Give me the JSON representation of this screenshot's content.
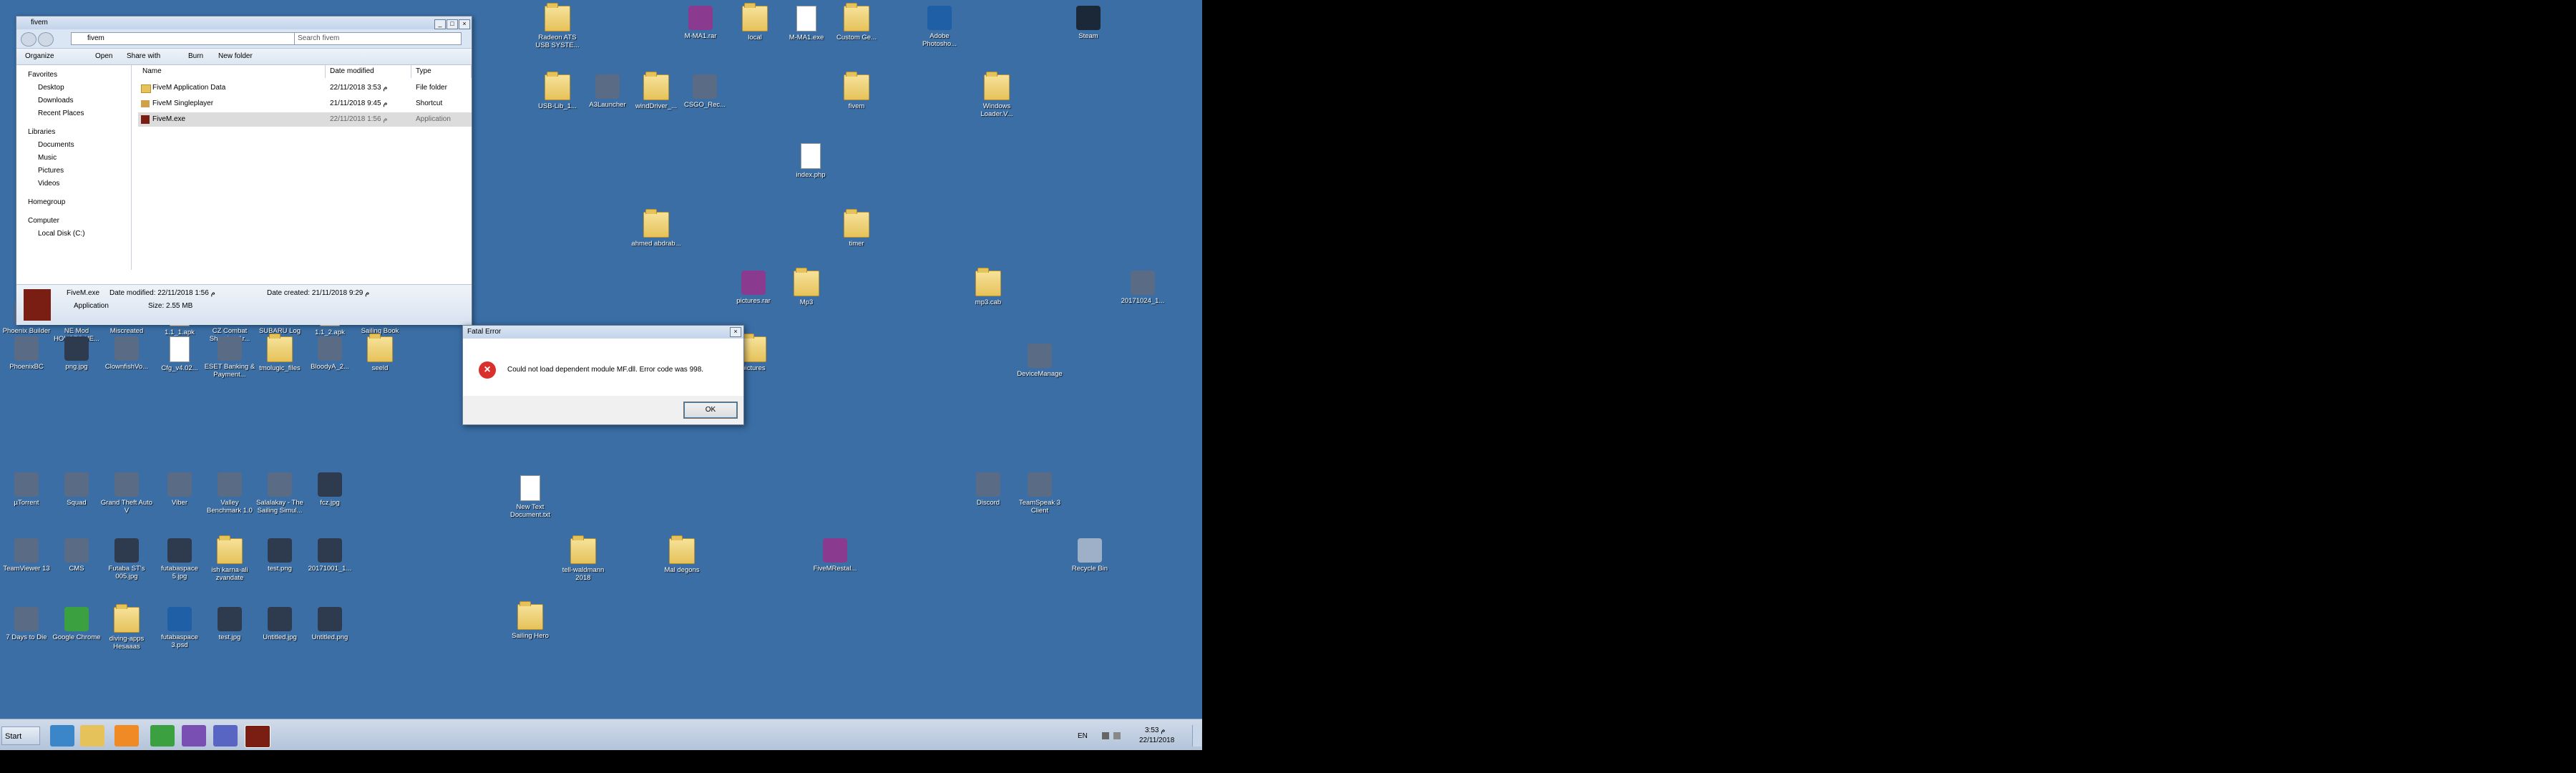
{
  "explorer": {
    "title": "fivem",
    "address": "fivem",
    "search_placeholder": "Search fivem",
    "toolbar": {
      "organize": "Organize",
      "open": "Open",
      "share": "Share with",
      "burn": "Burn",
      "new_folder": "New folder"
    },
    "nav": {
      "favorites": "Favorites",
      "desktop": "Desktop",
      "downloads": "Downloads",
      "recent": "Recent Places",
      "libraries": "Libraries",
      "documents": "Documents",
      "music": "Music",
      "pictures": "Pictures",
      "videos": "Videos",
      "homegroup": "Homegroup",
      "computer": "Computer",
      "local_disk": "Local Disk (C:)"
    },
    "columns": {
      "name": "Name",
      "date": "Date modified",
      "type": "Type"
    },
    "files": [
      {
        "name": "FiveM Application Data",
        "date": "22/11/2018 3:53 م",
        "type": "File folder"
      },
      {
        "name": "FiveM Singleplayer",
        "date": "21/11/2018 9:45 م",
        "type": "Shortcut"
      },
      {
        "name": "FiveM.exe",
        "date": "22/11/2018 1:56 م",
        "type": "Application"
      }
    ],
    "details": {
      "name": "FiveM.exe",
      "date_modified": "Date modified: 22/11/2018 1:56 م",
      "date_created": "Date created: 21/11/2018 9:29 م",
      "kind": "Application",
      "size": "Size: 2.55 MB"
    }
  },
  "dialog": {
    "title": "Fatal Error",
    "message": "Could not load dependent module MF.dll. Error code was 998.",
    "ok": "OK"
  },
  "desktop_icons": [
    {
      "label": "Radeon ATS USB SYSTE...",
      "kind": "folder"
    },
    {
      "label": "M-MA1.rar",
      "kind": "rar"
    },
    {
      "label": "local",
      "kind": "folder"
    },
    {
      "label": "M-MA1.exe",
      "kind": "doc"
    },
    {
      "label": "Custom Ge...",
      "kind": "folder"
    },
    {
      "label": "Adobe Photosho...",
      "kind": "ps"
    },
    {
      "label": "Steam",
      "kind": "steam"
    },
    {
      "label": "USB-Lib_1...",
      "kind": "folder"
    },
    {
      "label": "A3Launcher",
      "kind": "app"
    },
    {
      "label": "windDriver_...",
      "kind": "folder"
    },
    {
      "label": "CSGO_Rec...",
      "kind": "app"
    },
    {
      "label": "fivem",
      "kind": "folder"
    },
    {
      "label": "Windows Loader.V...",
      "kind": "folder"
    },
    {
      "label": "index.php",
      "kind": "doc"
    },
    {
      "label": "ahmed abdrab...",
      "kind": "folder"
    },
    {
      "label": "timer",
      "kind": "folder"
    },
    {
      "label": "Phoenix Builder",
      "kind": "app"
    },
    {
      "label": "NE Mod HOUSES NE...",
      "kind": "app"
    },
    {
      "label": "Misc­reated",
      "kind": "app"
    },
    {
      "label": "1.1_1.apk",
      "kind": "doc"
    },
    {
      "label": "CZ Combat Shooting Ar...",
      "kind": "app"
    },
    {
      "label": "SUBARU Log Tran...",
      "kind": "app"
    },
    {
      "label": "1.1_2.apk",
      "kind": "doc"
    },
    {
      "label": "Sailing Book",
      "kind": "app"
    },
    {
      "label": "pictures.rar",
      "kind": "rar"
    },
    {
      "label": "Mp3",
      "kind": "folder"
    },
    {
      "label": "mp3.cab",
      "kind": "folder"
    },
    {
      "label": "20171024_1...",
      "kind": "app"
    },
    {
      "label": "PhoenixBC",
      "kind": "app"
    },
    {
      "label": "png.jpg",
      "kind": "img"
    },
    {
      "label": "Clownfish­Vo...",
      "kind": "app"
    },
    {
      "label": "Cfg_v4.02...",
      "kind": "doc"
    },
    {
      "label": "ESET Banking & Payment...",
      "kind": "app"
    },
    {
      "label": "tmolugic_files",
      "kind": "folder"
    },
    {
      "label": "BloodyA_2...",
      "kind": "app"
    },
    {
      "label": "seeld",
      "kind": "folder"
    },
    {
      "label": "pictures",
      "kind": "folder"
    },
    {
      "label": "DeviceManage",
      "kind": "app"
    },
    {
      "label": "µTorrent",
      "kind": "app"
    },
    {
      "label": "Squad",
      "kind": "app"
    },
    {
      "label": "Grand Theft Auto V",
      "kind": "app"
    },
    {
      "label": "Viber",
      "kind": "app"
    },
    {
      "label": "Valley Benchmark 1.0",
      "kind": "app"
    },
    {
      "label": "Salalakay - The Sailing Simul...",
      "kind": "app"
    },
    {
      "label": "fcz.jpg",
      "kind": "img"
    },
    {
      "label": "New Text Document.txt",
      "kind": "doc"
    },
    {
      "label": "Discord",
      "kind": "app"
    },
    {
      "label": "TeamSpeak 3 Client",
      "kind": "app"
    },
    {
      "label": "TeamViewer 13",
      "kind": "app"
    },
    {
      "label": "CMS",
      "kind": "app"
    },
    {
      "label": "Futaba ST's 005.jpg",
      "kind": "img"
    },
    {
      "label": "futaba­space 5.jpg",
      "kind": "img"
    },
    {
      "label": "ish karna-ali zvandate",
      "kind": "folder"
    },
    {
      "label": "test.png",
      "kind": "img"
    },
    {
      "label": "20171001_1...",
      "kind": "img"
    },
    {
      "label": "tell-waldmann 2018",
      "kind": "folder"
    },
    {
      "label": "Mal degons",
      "kind": "folder"
    },
    {
      "label": "FiveMRestal...",
      "kind": "rar"
    },
    {
      "label": "Recycle Bin",
      "kind": "bin"
    },
    {
      "label": "7 Days to Die",
      "kind": "app"
    },
    {
      "label": "Google Chrome",
      "kind": "chrome"
    },
    {
      "label": "diving-apps Hesaaas",
      "kind": "folder"
    },
    {
      "label": "futaba­space 3.psd",
      "kind": "ps"
    },
    {
      "label": "test.jpg",
      "kind": "img"
    },
    {
      "label": "Untitled.jpg",
      "kind": "img"
    },
    {
      "label": "Untitled.png",
      "kind": "img"
    },
    {
      "label": "Sailing Hero",
      "kind": "folder"
    }
  ],
  "taskbar": {
    "start": "Start",
    "lang": "EN",
    "time": "3:53 م",
    "date": "22/11/2018"
  }
}
